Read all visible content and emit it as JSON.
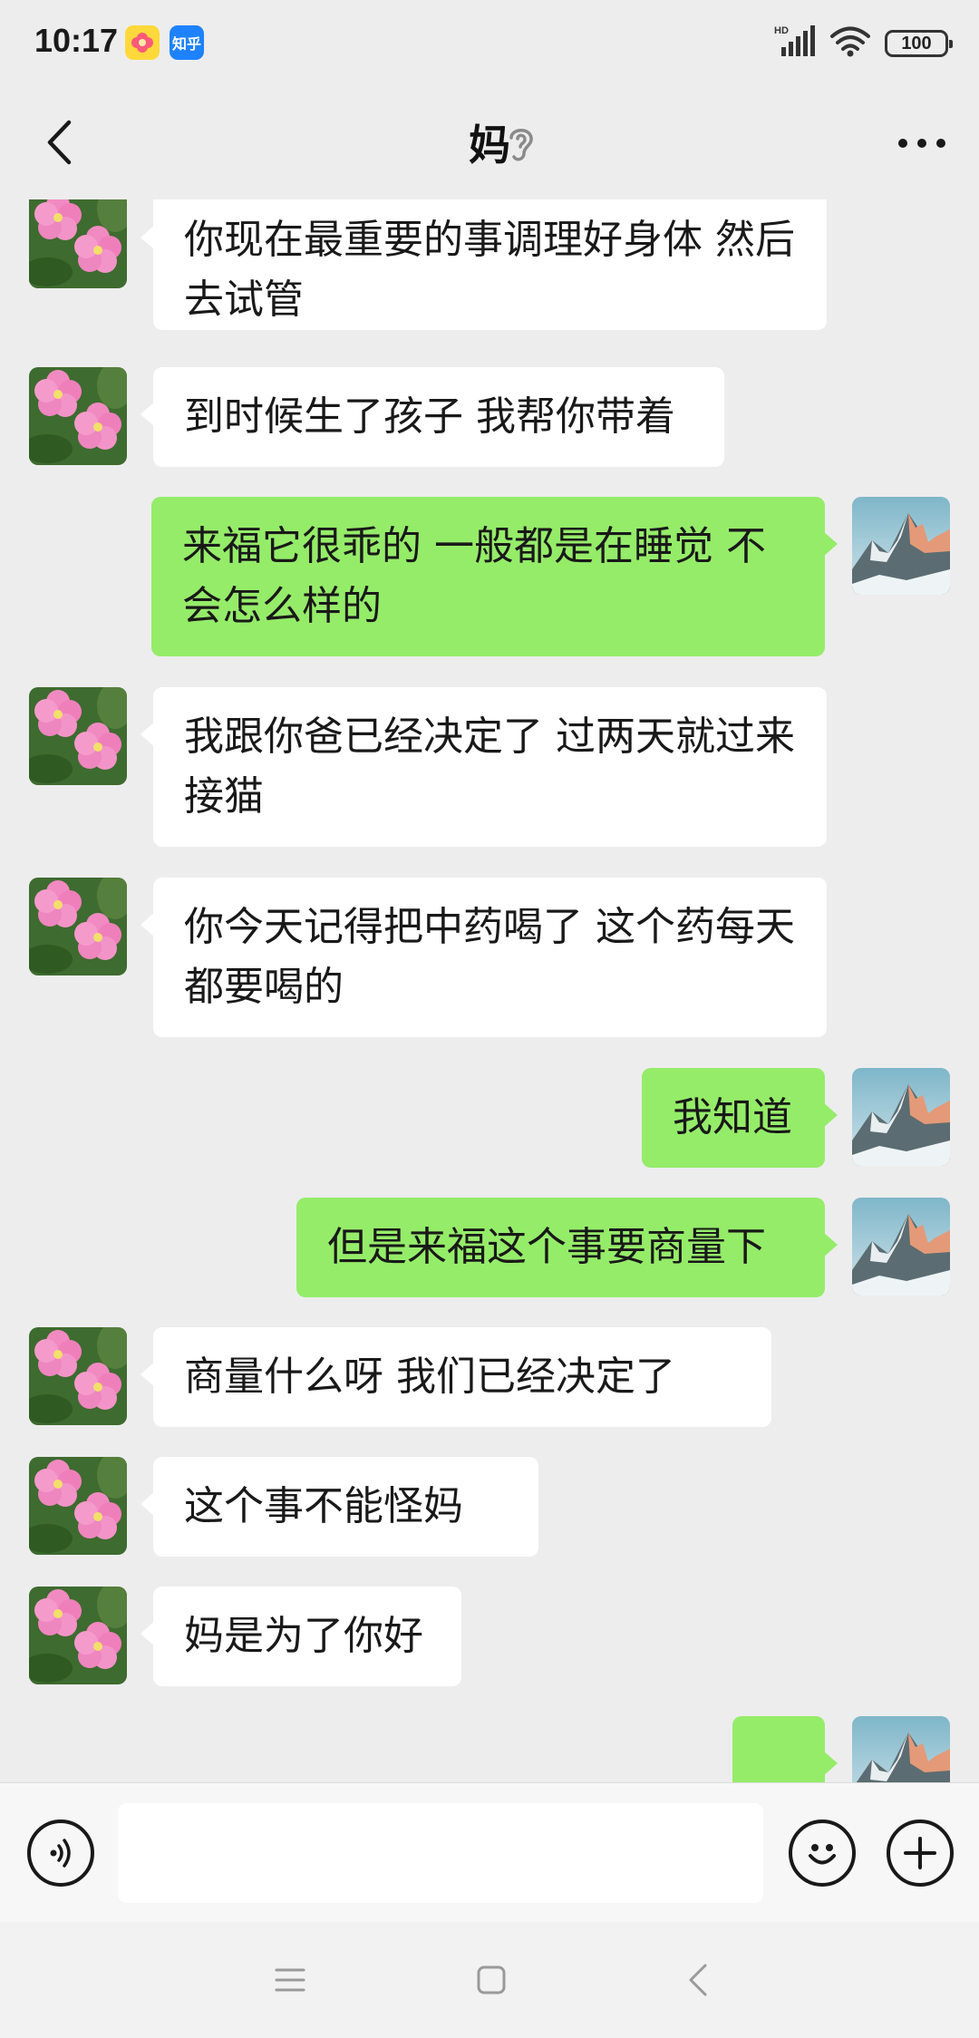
{
  "status_bar": {
    "time": "10:17",
    "zhihu_label": "知乎",
    "network_label": "HD",
    "battery": "100"
  },
  "header": {
    "title": "妈",
    "back_icon": "back-chevron-icon",
    "mute_icon": "ear-icon",
    "more_icon": "more-dots-icon"
  },
  "messages": [
    {
      "side": "in",
      "sender": "妈",
      "text": "你现在最重要的事调理好身体  然后去试管"
    },
    {
      "side": "in",
      "sender": "妈",
      "text": "到时候生了孩子 我帮你带着"
    },
    {
      "side": "out",
      "sender": "me",
      "text": "来福它很乖的  一般都是在睡觉  不会怎么样的"
    },
    {
      "side": "in",
      "sender": "妈",
      "text": "我跟你爸已经决定了  过两天就过来接猫"
    },
    {
      "side": "in",
      "sender": "妈",
      "text": "你今天记得把中药喝了   这个药每天都要喝的"
    },
    {
      "side": "out",
      "sender": "me",
      "text": "我知道"
    },
    {
      "side": "out",
      "sender": "me",
      "text": "但是来福这个事要商量下"
    },
    {
      "side": "in",
      "sender": "妈",
      "text": "商量什么呀   我们已经决定了"
    },
    {
      "side": "in",
      "sender": "妈",
      "text": "这个事不能怪妈"
    },
    {
      "side": "in",
      "sender": "妈",
      "text": "妈是为了你好"
    },
    {
      "side": "out",
      "sender": "me",
      "text": "..."
    }
  ],
  "input": {
    "value": "",
    "voice_icon": "voice-icon",
    "emoji_icon": "emoji-icon",
    "plus_icon": "plus-icon"
  },
  "colors": {
    "background": "#ededed",
    "outgoing_bubble": "#95ec69",
    "incoming_bubble": "#ffffff"
  }
}
